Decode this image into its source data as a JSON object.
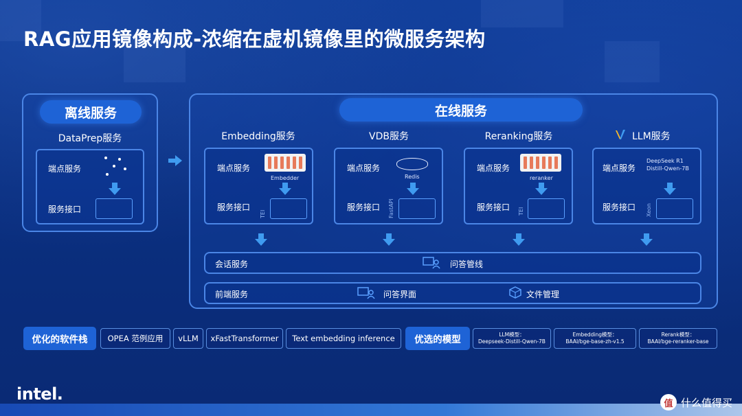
{
  "title": "RAG应用镜像构成-浓缩在虚机镜像里的微服务架构",
  "offline": {
    "header": "离线服务",
    "service_name": "DataPrep服务",
    "endpoint_label": "端点服务",
    "interface_label": "服务接口"
  },
  "online": {
    "header": "在线服务",
    "services": [
      {
        "name": "Embedding服务",
        "endpoint_label": "端点服务",
        "interface_label": "服务接口",
        "engine": "Embedder",
        "side_label": "TEI"
      },
      {
        "name": "VDB服务",
        "endpoint_label": "端点服务",
        "interface_label": "服务接口",
        "engine": "Redis",
        "side_label": "FastAPI"
      },
      {
        "name": "Reranking服务",
        "endpoint_label": "端点服务",
        "interface_label": "服务接口",
        "engine": "reranker",
        "side_label": "TEI"
      },
      {
        "name": "LLM服务",
        "endpoint_label": "端点服务",
        "interface_label": "服务接口",
        "engine_line1": "DeepSeek R1",
        "engine_line2": "Distill-Qwen-7B",
        "side_label": "Xeon"
      }
    ],
    "session_row": {
      "label": "会话服务",
      "item": "问答管线"
    },
    "frontend_row": {
      "label": "前端服务",
      "item1": "问答界面",
      "item2": "文件管理"
    }
  },
  "software_stack": {
    "header": "优化的软件栈",
    "items": [
      "OPEA 范例应用",
      "vLLM",
      "xFastTransformer",
      "Text embedding inference"
    ]
  },
  "models": {
    "header": "优选的模型",
    "items": [
      {
        "line1": "LLM模型：",
        "line2": "Deepseek-Distill-Qwen-7B"
      },
      {
        "line1": "Embedding模型：",
        "line2": "BAAI/bge-base-zh-v1.5"
      },
      {
        "line1": "Rerank模型：",
        "line2": "BAAI/bge-reranker-base"
      }
    ]
  },
  "logo": "intel.",
  "watermark": {
    "badge": "值",
    "text": "什么值得买"
  },
  "colors": {
    "background": "#0b3183",
    "accent": "#1e63d6",
    "border": "#4b86e6",
    "arrow": "#3f9bf0"
  }
}
